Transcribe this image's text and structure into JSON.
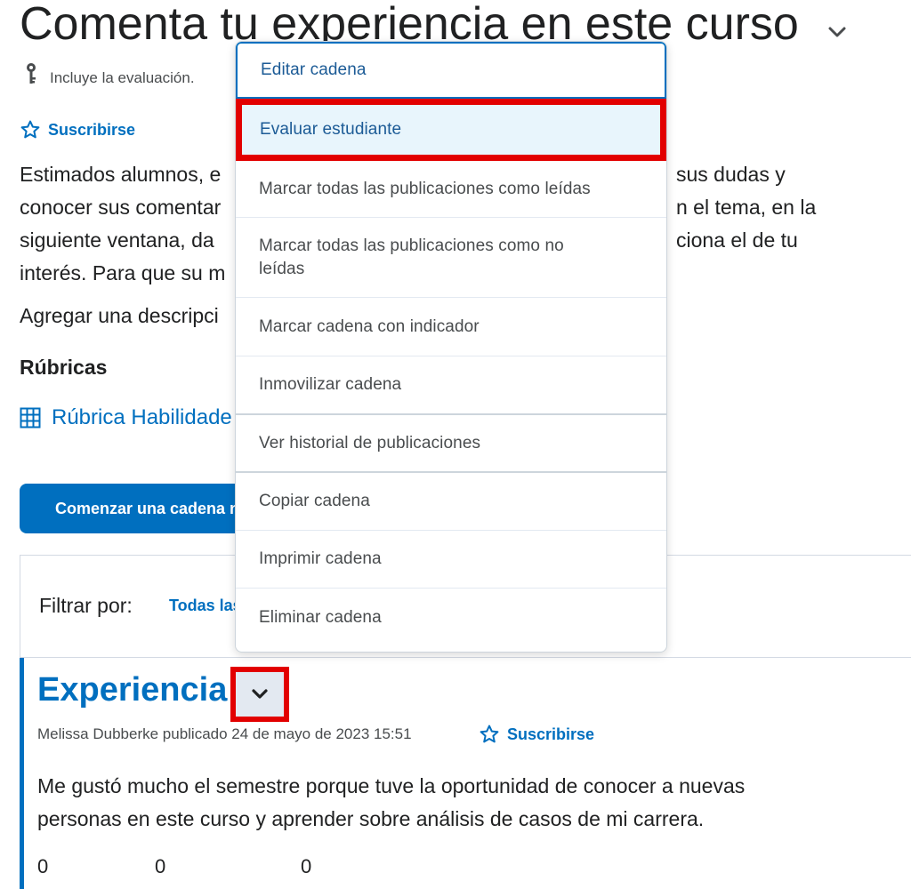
{
  "header": {
    "title": "Comenta tu experiencia en este curso",
    "includes_text": "Incluye la evaluación.",
    "subscribe_label": "Suscribirse"
  },
  "description": {
    "lines": [
      "Estimados alumnos, e",
      "conocer sus comentar",
      "siguiente ventana, da",
      "interés. Para que su m"
    ],
    "lines_right": [
      "sus dudas y",
      "n el tema, en la",
      "ciona el de tu",
      ""
    ],
    "add_description": "Agregar una descripci"
  },
  "rubrics": {
    "heading": "Rúbricas",
    "link_label": "Rúbrica Habilidade"
  },
  "start_button_label": "Comenzar una cadena n",
  "filter": {
    "label": "Filtrar por:",
    "value": "Todas las"
  },
  "menu": {
    "items": [
      {
        "label": "Editar cadena"
      },
      {
        "label": "Evaluar estudiante"
      },
      {
        "label": "Marcar todas las publicaciones como leídas"
      },
      {
        "label": "Marcar todas las publicaciones como no leídas"
      },
      {
        "label": "Marcar cadena con indicador"
      },
      {
        "label": "Inmovilizar cadena"
      },
      {
        "label": "Ver historial de publicaciones"
      },
      {
        "label": "Copiar cadena"
      },
      {
        "label": "Imprimir cadena"
      },
      {
        "label": "Eliminar cadena"
      }
    ]
  },
  "post": {
    "title": "Experiencia",
    "meta": "Melissa Dubberke publicado 24 de mayo de 2023 15:51",
    "subscribe_label": "Suscribirse",
    "body_lines": [
      "Me gustó mucho el semestre porque tuve la oportunidad de conocer a nuevas",
      "personas en este curso y aprender sobre análisis de casos de mi carrera."
    ],
    "counts": [
      "0",
      "0",
      "0"
    ]
  },
  "colors": {
    "accent": "#006fbf",
    "highlight_border": "#e20000",
    "menu_highlight_bg": "#e8f5fc"
  },
  "icons": [
    "key-icon",
    "star-icon",
    "grid-icon",
    "chevron-down-icon"
  ]
}
